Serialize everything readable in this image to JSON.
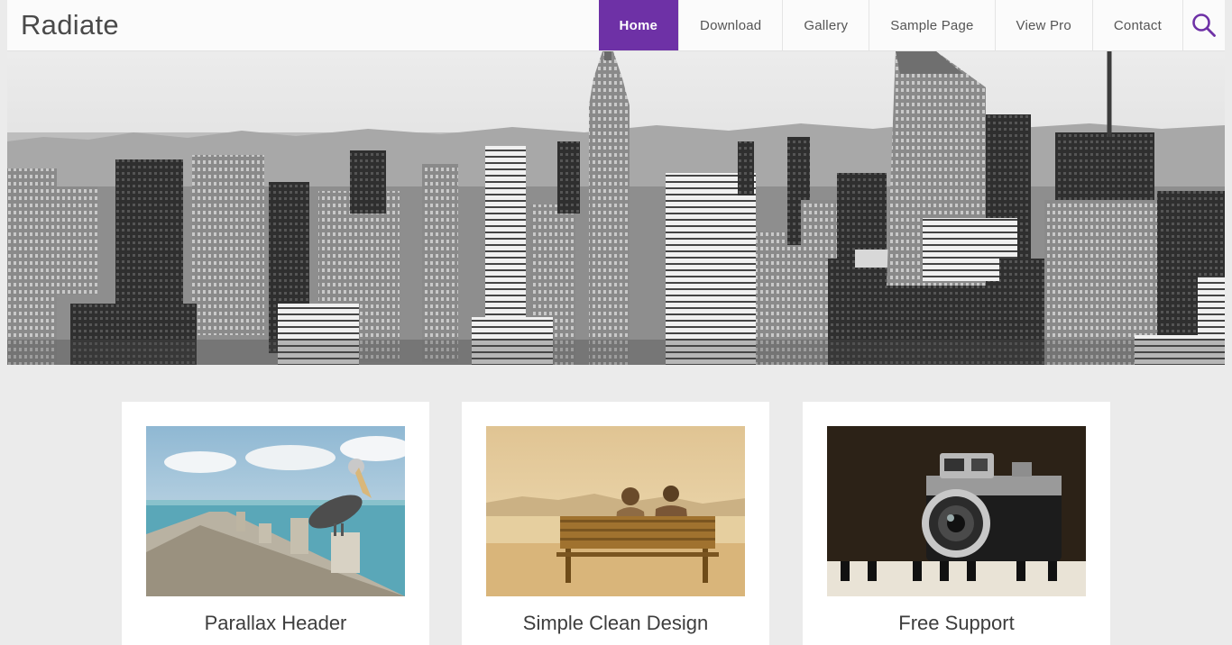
{
  "header": {
    "site_title": "Radiate",
    "nav": [
      {
        "label": "Home",
        "active": true
      },
      {
        "label": "Download",
        "active": false
      },
      {
        "label": "Gallery",
        "active": false
      },
      {
        "label": "Sample Page",
        "active": false
      },
      {
        "label": "View Pro",
        "active": false
      },
      {
        "label": "Contact",
        "active": false
      }
    ],
    "search_icon": "search-icon"
  },
  "hero": {
    "image": "city-skyline-photo"
  },
  "features": [
    {
      "title": "Parallax Header",
      "image": "pelican-pier-photo"
    },
    {
      "title": "Simple Clean Design",
      "image": "couple-on-bench-photo"
    },
    {
      "title": "Free Support",
      "image": "vintage-camera-photo"
    }
  ],
  "colors": {
    "accent": "#6e31a6",
    "page_background": "#ebebeb",
    "card_background": "#ffffff"
  }
}
